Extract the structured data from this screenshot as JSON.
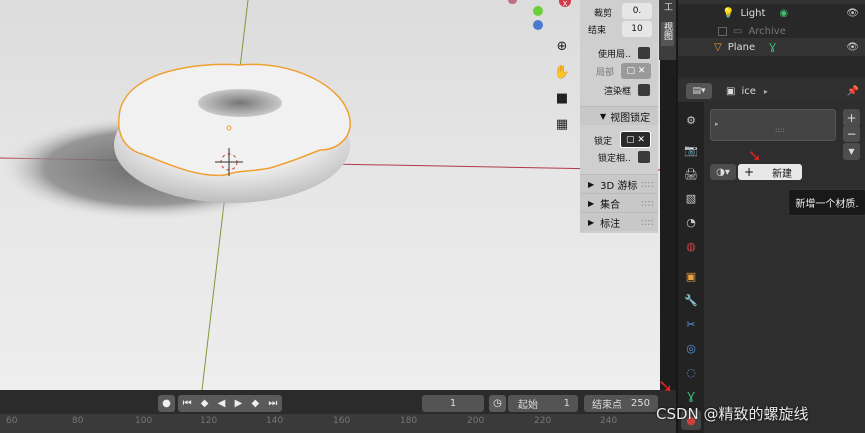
{
  "viewport": {
    "gizmo_x_label": "X",
    "tools": [
      "zoom-icon",
      "hand-pan-icon",
      "camera-icon",
      "grid-icon"
    ],
    "npanel": {
      "clip_label": "裁剪",
      "clip_value": "0.",
      "end_label": "结束",
      "end_value": "10",
      "use_local_label": "使用局..",
      "local_label": "局部",
      "render_region_label": "渲染框",
      "view_lock_label": "视图锁定",
      "lock_label": "锁定",
      "lock_relative_label": "锁定相..",
      "cursor_label": "3D 游标",
      "collection_label": "集合",
      "annotation_label": "标注",
      "tab_label": "视图",
      "tab2_label": "工具"
    }
  },
  "timeline": {
    "current_frame": "1",
    "start_label": "起始",
    "start_value": "1",
    "end_label": "结束点",
    "end_value": "250",
    "ruler_ticks": [
      "60",
      "80",
      "100",
      "120",
      "140",
      "160",
      "180",
      "200",
      "220",
      "240"
    ]
  },
  "outliner": {
    "items": [
      {
        "name": "Light",
        "icon": "light-icon"
      },
      {
        "name": "Archive",
        "icon": "archive-icon"
      },
      {
        "name": "Plane",
        "icon": "mesh-icon"
      }
    ]
  },
  "properties": {
    "object_name": "ice",
    "new_button": "新建",
    "plus": "+",
    "minus": "−",
    "list_dots": "::::",
    "tooltip": "新增一个材质."
  },
  "watermark": "CSDN @精致的螺旋线",
  "colors": {
    "selection_outline": "#f0a030",
    "axis_x": "#b03a4a",
    "axis_y": "#7a9a3a",
    "arrow": "#e02020"
  }
}
